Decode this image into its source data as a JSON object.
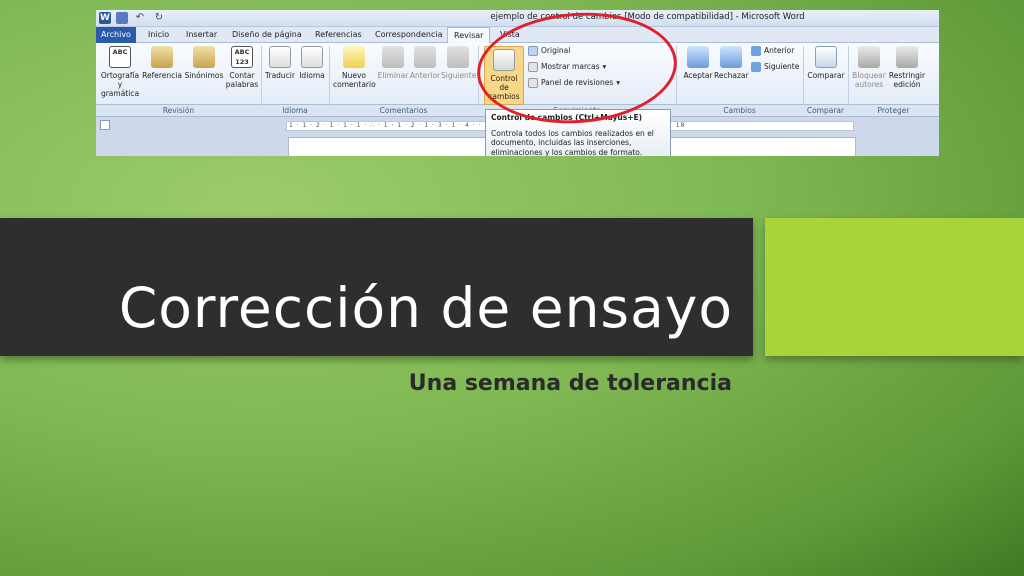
{
  "word_window": {
    "title": "ejemplo de control de cambios [Modo de compatibilidad] - Microsoft Word",
    "tabs": [
      "Archivo",
      "Inicio",
      "Insertar",
      "Diseño de página",
      "Referencias",
      "Correspondencia",
      "Revisar",
      "Vista"
    ],
    "active_tab": "Revisar",
    "ribbon": {
      "revision": {
        "group_label": "Revisión",
        "spelling": "Ortografía y gramática",
        "reference": "Referencia",
        "synonyms": "Sinónimos",
        "count_words": "Contar palabras"
      },
      "idioma": {
        "group_label": "Idioma",
        "translate": "Traducir",
        "language": "Idioma"
      },
      "comentarios": {
        "group_label": "Comentarios",
        "new_comment": "Nuevo comentario",
        "delete": "Eliminar",
        "previous": "Anterior",
        "next": "Siguiente"
      },
      "seguimiento": {
        "group_label": "Seguimiento",
        "track_changes": "Control de cambios",
        "original": "Original",
        "show_markup": "Mostrar marcas",
        "review_pane": "Panel de revisiones"
      },
      "cambios": {
        "group_label": "Cambios",
        "accept": "Aceptar",
        "reject": "Rechazar",
        "previous": "Anterior",
        "next": "Siguiente"
      },
      "comparar": {
        "group_label": "Comparar",
        "compare": "Comparar"
      },
      "proteger": {
        "group_label": "Proteger",
        "block_authors": "Bloquear autores",
        "restrict_editing": "Restringir edición"
      }
    },
    "ruler_text": "1 · 1 · 2 · 1 · 1 · 1 · ∴ · 1 · 1 · 2 · 1 · 3 · 1 · 4 ·   · 12 · 1 · 13 · 1 · 14 · 1 · 15 · 1 · 16 · 1 · 17 · 1 · 18",
    "tooltip": {
      "title": "Control de cambios (Ctrl+Mayús+E)",
      "body": "Controla todos los cambios realizados en el documento, incluidas las inserciones, eliminaciones y los cambios de formato."
    },
    "highlight_color": "#e0202a"
  },
  "slide": {
    "title": "Corrección de ensayo",
    "subtitle": "Una semana de tolerancia",
    "colors": {
      "title_band": "#2e2e2e",
      "accent": "#a6d43a",
      "background": "#7fb853"
    }
  }
}
